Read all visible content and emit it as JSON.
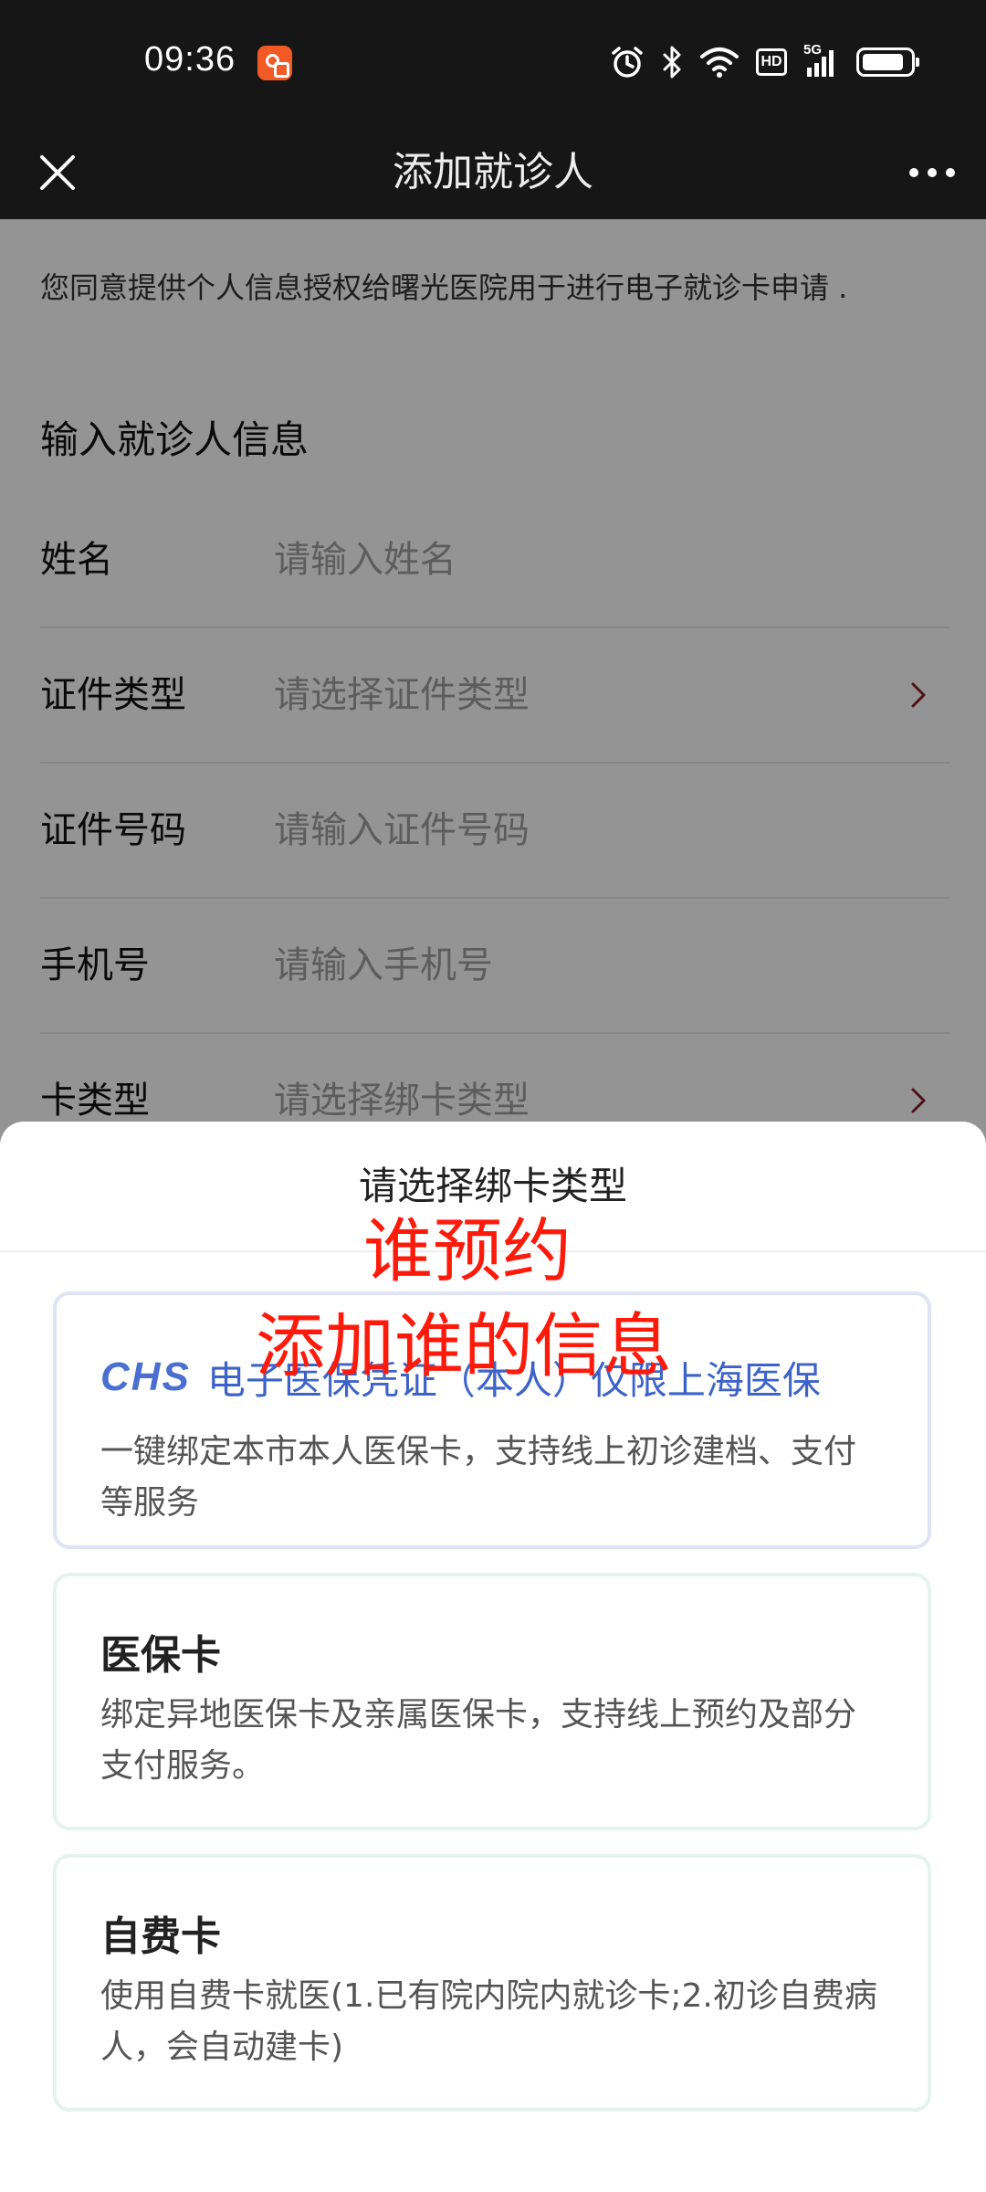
{
  "status_bar": {
    "time": "09:36",
    "app_icon": "xiaohongshu-style-app-icon",
    "icons": [
      "alarm-icon",
      "bluetooth-icon",
      "wifi-icon",
      "hd-badge",
      "5g-signal-icon",
      "battery-icon"
    ],
    "hd_label": "HD",
    "network_label": "5G"
  },
  "nav": {
    "title": "添加就诊人",
    "close_icon": "close-icon",
    "more_icon": "more-icon"
  },
  "page": {
    "notice": "您同意提供个人信息授权给曙光医院用于进行电子就诊卡申请 .",
    "section_title": "输入就诊人信息",
    "fields": [
      {
        "label": "姓名",
        "placeholder": "请输入姓名",
        "chevron": false
      },
      {
        "label": "证件类型",
        "placeholder": "请选择证件类型",
        "chevron": true
      },
      {
        "label": "证件号码",
        "placeholder": "请输入证件号码",
        "chevron": false
      },
      {
        "label": "手机号",
        "placeholder": "请输入手机号",
        "chevron": false
      },
      {
        "label": "卡类型",
        "placeholder": "请选择绑卡类型",
        "chevron": true
      }
    ]
  },
  "sheet": {
    "title": "请选择绑卡类型",
    "options": [
      {
        "logo": "CHS",
        "title": "电子医保凭证（本人）仅限上海医保",
        "desc": "一键绑定本市本人医保卡，支持线上初诊建档、支付等服务"
      },
      {
        "title": "医保卡",
        "desc": "绑定异地医保卡及亲属医保卡，支持线上预约及部分支付服务。"
      },
      {
        "title": "自费卡",
        "desc": "使用自费卡就医(1.已有院内院内就诊卡;2.初诊自费病人，会自动建卡)"
      }
    ]
  },
  "annotations": {
    "line1": "谁预约",
    "line2": "添加谁的信息"
  },
  "colors": {
    "status_bar_bg": "#161616",
    "chs_blue": "#3d63c9",
    "card_border": "#e4f3f0",
    "annotation_red": "#ff1a0a"
  }
}
